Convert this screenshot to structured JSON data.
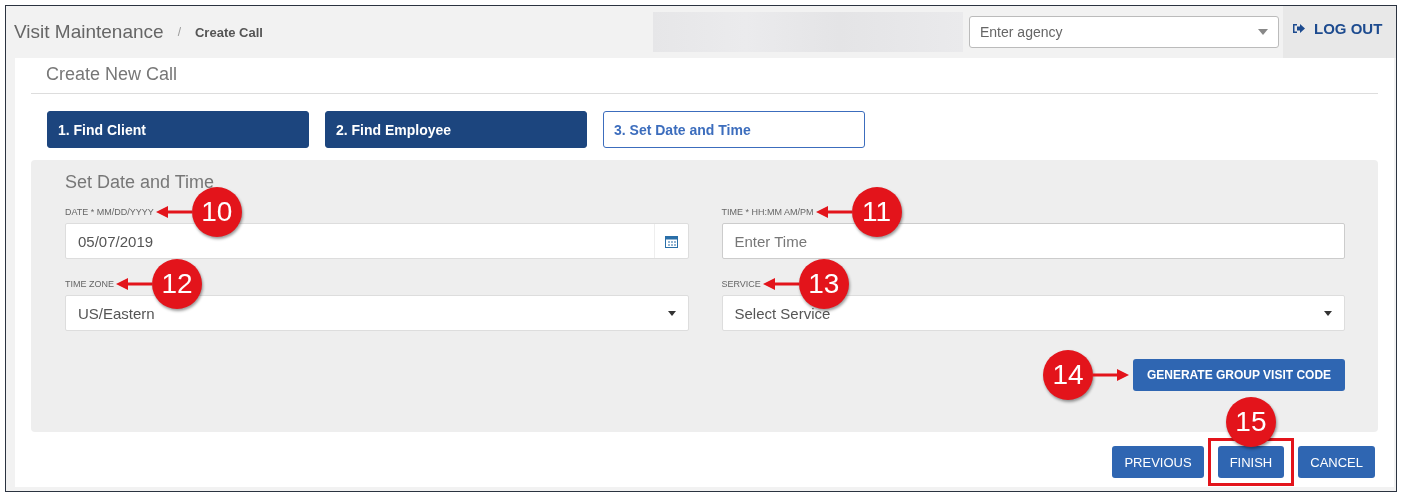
{
  "header": {
    "title": "Visit Maintenance",
    "separator": "/",
    "breadcrumb": "Create Call",
    "agency": {
      "placeholder": "Enter agency"
    },
    "logout": "LOG OUT"
  },
  "page_title": "Create New Call",
  "steps": [
    {
      "label": "1. Find Client",
      "selected": false
    },
    {
      "label": "2. Find Employee",
      "selected": false
    },
    {
      "label": "3. Set Date and Time",
      "selected": true
    }
  ],
  "section": {
    "title": "Set Date and Time",
    "fields": [
      {
        "kind": "date",
        "label": "DATE * MM/DD/YYYY",
        "value": "05/07/2019",
        "callout": "10"
      },
      {
        "kind": "text",
        "label": "TIME * HH:MM AM/PM",
        "placeholder": "Enter Time",
        "callout": "11"
      },
      {
        "kind": "select",
        "label": "TIME ZONE",
        "value": "US/Eastern",
        "callout": "12"
      },
      {
        "kind": "select",
        "label": "SERVICE",
        "value": "Select Service",
        "callout": "13"
      }
    ],
    "generate_button": {
      "label": "GENERATE GROUP VISIT CODE",
      "callout": "14"
    }
  },
  "actions": [
    {
      "label": "PREVIOUS",
      "highlighted": false
    },
    {
      "label": "FINISH",
      "callout": "15",
      "highlighted": true
    },
    {
      "label": "CANCEL",
      "highlighted": false
    }
  ]
}
